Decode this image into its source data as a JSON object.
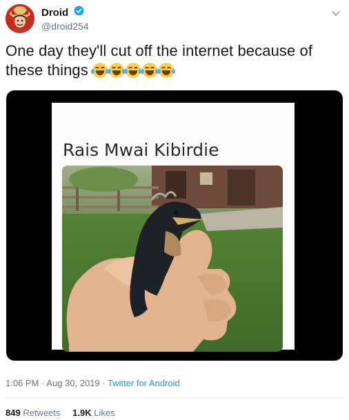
{
  "user": {
    "display_name": "Droid",
    "handle": "@droid254",
    "verified": true
  },
  "tweet": {
    "text": "One day they'll cut off the internet because of these things",
    "emojis": [
      "face-with-tears-of-joy",
      "face-with-tears-of-joy",
      "face-with-tears-of-joy",
      "face-with-tears-of-joy",
      "face-with-tears-of-joy"
    ]
  },
  "media": {
    "caption": "Rais Mwai Kibirdie"
  },
  "meta": {
    "time": "1:06 PM",
    "separator": "·",
    "date": "Aug 30, 2019",
    "source": "Twitter for Android"
  },
  "stats": {
    "retweets_count": "849",
    "retweets_label": "Retweets",
    "likes_count": "1.9K",
    "likes_label": "Likes"
  },
  "colors": {
    "link": "#1b95e0",
    "secondary_text": "#657786",
    "verified_badge": "#1da1f2"
  }
}
